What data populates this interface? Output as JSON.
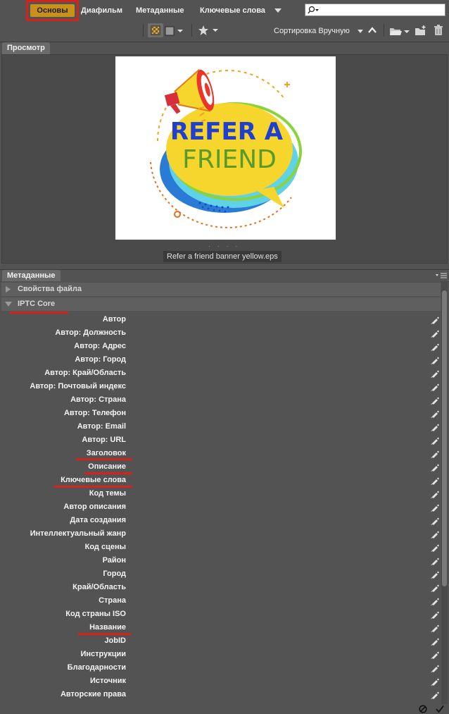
{
  "workspaces": {
    "tabs": [
      "Основы",
      "Диафильм",
      "Метаданные",
      "Ключевые слова"
    ]
  },
  "search": {
    "value": "",
    "placeholder": ""
  },
  "toolbar": {
    "sort_label": "Сортировка Вручную"
  },
  "preview": {
    "tab_label": "Просмотр",
    "filename": "Refer a friend banner yellow.eps",
    "image_text_line1": "REFER A",
    "image_text_line2": "FRIEND"
  },
  "metadata": {
    "tab_label": "Метаданные",
    "sections": {
      "file_props": "Свойства файла",
      "iptc_core": "IPTC Core"
    },
    "fields": [
      "Автор",
      "Автор: Должность",
      "Автор: Адрес",
      "Автор: Город",
      "Автор: Край/Область",
      "Автор: Почтовый индекс",
      "Автор: Страна",
      "Автор: Телефон",
      "Автор: Email",
      "Автор: URL",
      "Заголовок",
      "Описание",
      "Ключевые слова",
      "Код темы",
      "Автор описания",
      "Дата создания",
      "Интеллектуальный жанр",
      "Код сцены",
      "Район",
      "Город",
      "Край/Область",
      "Страна",
      "Код страны ISO",
      "Название",
      "JobID",
      "Инструкции",
      "Благодарности",
      "Источник",
      "Авторские права"
    ]
  },
  "colors": {
    "active_workspace": "#c8911a",
    "highlight_red": "#d4231b",
    "panel_bg": "#535353"
  }
}
